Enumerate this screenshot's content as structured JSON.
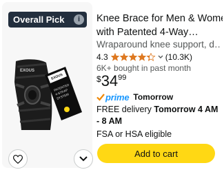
{
  "badge": {
    "label": "Overall Pick",
    "info_icon": "i"
  },
  "product": {
    "title_line1": "Knee Brace for Men & Women",
    "title_line2": "with Patented 4-Way…",
    "subtitle": "Wraparound knee support, d…",
    "rating_value": "4.3",
    "rating_stars": 4.3,
    "review_count": "(10.3K)",
    "bought_text": "6K+ bought in past month",
    "price_symbol": "$",
    "price_whole": "34",
    "price_fraction": "99",
    "image_brand_text": "EXOUS",
    "image_tag_lines": [
      "PATENTED",
      "4-STRAP",
      "SYSTEM"
    ]
  },
  "shipping": {
    "prime_label": "prime",
    "prime_day": "Tomorrow",
    "delivery_prefix": "FREE delivery ",
    "delivery_time": "Tomorrow 4 AM - 8 AM",
    "fsa_text": "FSA or HSA eligible"
  },
  "actions": {
    "add_to_cart_label": "Add to cart"
  },
  "colors": {
    "badge_bg": "#232f3e",
    "star": "#de7921",
    "prime_blue": "#1a98ff",
    "cart_button": "#ffd814"
  }
}
